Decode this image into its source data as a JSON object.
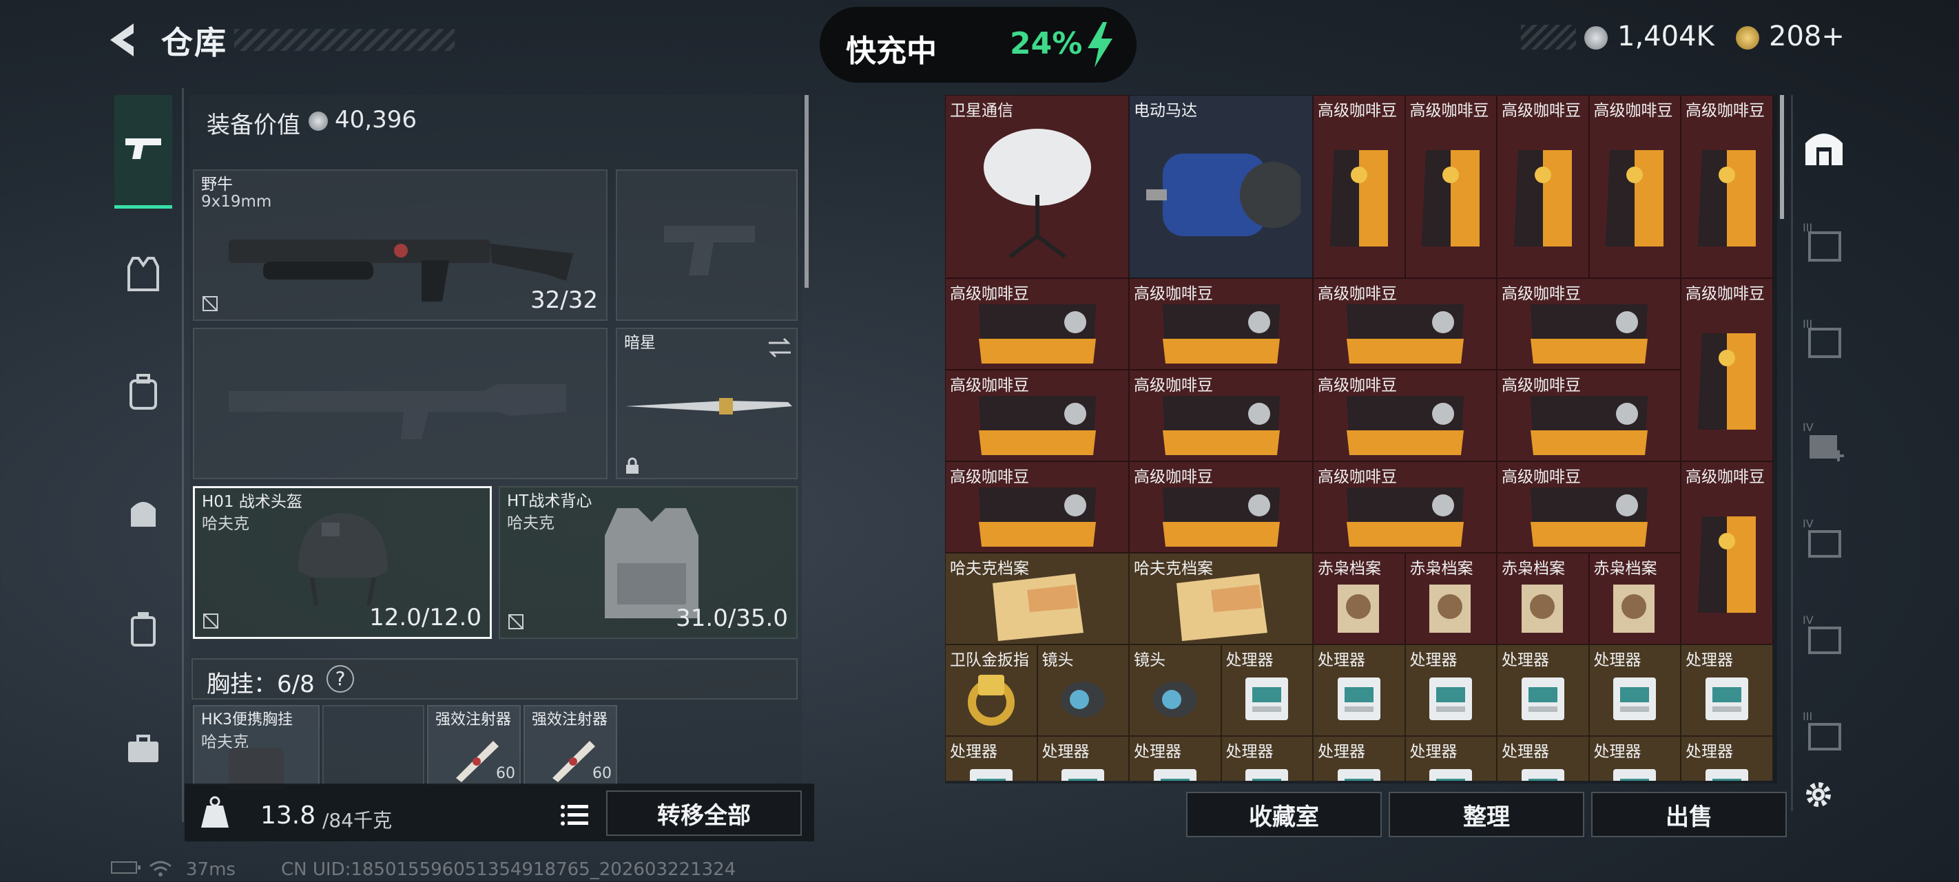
{
  "header": {
    "title": "仓库",
    "charging_label": "快充中",
    "charging_percent": "24%",
    "currency_1": "1,404K",
    "currency_2": "208+"
  },
  "equipment": {
    "label": "装备价值",
    "value": "40,396",
    "primary_weapon": {
      "name": "野牛",
      "sub": "9x19mm",
      "ammo": "32/32"
    },
    "melee": {
      "name": "暗星"
    },
    "helmet": {
      "name": "H01 战术头盔",
      "sub": "哈夫克",
      "durability": "12.0/12.0"
    },
    "armor": {
      "name": "HT战术背心",
      "sub": "哈夫克",
      "durability": "31.0/35.0"
    },
    "rig": {
      "label": "胸挂：6/8",
      "help": "?"
    },
    "rig_items": [
      {
        "name": "HK3便携胸挂",
        "sub": "哈夫克"
      },
      {
        "name": "强效注射器",
        "qty": "60"
      },
      {
        "name": "强效注射器",
        "qty": "60"
      }
    ]
  },
  "bottom": {
    "weight": "13.8",
    "weight_max": "/84千克",
    "transfer_all": "转移全部",
    "vault": "收藏室",
    "sort": "整理",
    "sell": "出售"
  },
  "status": {
    "ping": "37ms",
    "uid": "CN UID:1850155960513549187​65_202603221324"
  },
  "warehouse": {
    "items": [
      {
        "name": "卫星通信",
        "color": "red",
        "art": "dish",
        "x": 0,
        "y": 0,
        "w": 2,
        "h": 2
      },
      {
        "name": "电动马达",
        "color": "blue",
        "art": "motor",
        "x": 2,
        "y": 0,
        "w": 2,
        "h": 2
      },
      {
        "name": "高级咖啡豆",
        "color": "red",
        "art": "bag",
        "x": 4,
        "y": 0,
        "w": 1,
        "h": 2
      },
      {
        "name": "高级咖啡豆",
        "color": "red",
        "art": "bag",
        "x": 5,
        "y": 0,
        "w": 1,
        "h": 2
      },
      {
        "name": "高级咖啡豆",
        "color": "red",
        "art": "bag",
        "x": 6,
        "y": 0,
        "w": 1,
        "h": 2
      },
      {
        "name": "高级咖啡豆",
        "color": "red",
        "art": "bag",
        "x": 7,
        "y": 0,
        "w": 1,
        "h": 2
      },
      {
        "name": "高级咖啡豆",
        "color": "red",
        "art": "bag",
        "x": 8,
        "y": 0,
        "w": 1,
        "h": 2
      },
      {
        "name": "高级咖啡豆",
        "color": "red",
        "art": "bagh",
        "x": 0,
        "y": 2,
        "w": 2,
        "h": 1
      },
      {
        "name": "高级咖啡豆",
        "color": "red",
        "art": "bagh",
        "x": 2,
        "y": 2,
        "w": 2,
        "h": 1
      },
      {
        "name": "高级咖啡豆",
        "color": "red",
        "art": "bagh",
        "x": 4,
        "y": 2,
        "w": 2,
        "h": 1
      },
      {
        "name": "高级咖啡豆",
        "color": "red",
        "art": "bagh",
        "x": 6,
        "y": 2,
        "w": 2,
        "h": 1
      },
      {
        "name": "高级咖啡豆",
        "color": "red",
        "art": "bag",
        "x": 8,
        "y": 2,
        "w": 1,
        "h": 2
      },
      {
        "name": "高级咖啡豆",
        "color": "red",
        "art": "bagh",
        "x": 0,
        "y": 3,
        "w": 2,
        "h": 1
      },
      {
        "name": "高级咖啡豆",
        "color": "red",
        "art": "bagh",
        "x": 2,
        "y": 3,
        "w": 2,
        "h": 1
      },
      {
        "name": "高级咖啡豆",
        "color": "red",
        "art": "bagh",
        "x": 4,
        "y": 3,
        "w": 2,
        "h": 1
      },
      {
        "name": "高级咖啡豆",
        "color": "red",
        "art": "bagh",
        "x": 6,
        "y": 3,
        "w": 2,
        "h": 1
      },
      {
        "name": "高级咖啡豆",
        "color": "red",
        "art": "bagh",
        "x": 0,
        "y": 4,
        "w": 2,
        "h": 1
      },
      {
        "name": "高级咖啡豆",
        "color": "red",
        "art": "bagh",
        "x": 2,
        "y": 4,
        "w": 2,
        "h": 1
      },
      {
        "name": "高级咖啡豆",
        "color": "red",
        "art": "bagh",
        "x": 4,
        "y": 4,
        "w": 2,
        "h": 1
      },
      {
        "name": "高级咖啡豆",
        "color": "red",
        "art": "bagh",
        "x": 6,
        "y": 4,
        "w": 2,
        "h": 1
      },
      {
        "name": "高级咖啡豆",
        "color": "red",
        "art": "bag",
        "x": 8,
        "y": 4,
        "w": 1,
        "h": 2
      },
      {
        "name": "哈夫克档案",
        "color": "gold",
        "art": "folder",
        "x": 0,
        "y": 5,
        "w": 2,
        "h": 1
      },
      {
        "name": "哈夫克档案",
        "color": "gold",
        "art": "folder",
        "x": 2,
        "y": 5,
        "w": 2,
        "h": 1
      },
      {
        "name": "赤枭档案",
        "color": "red",
        "art": "doc",
        "x": 4,
        "y": 5,
        "w": 1,
        "h": 1
      },
      {
        "name": "赤枭档案",
        "color": "red",
        "art": "doc",
        "x": 5,
        "y": 5,
        "w": 1,
        "h": 1
      },
      {
        "name": "赤枭档案",
        "color": "red",
        "art": "doc",
        "x": 6,
        "y": 5,
        "w": 1,
        "h": 1
      },
      {
        "name": "赤枭档案",
        "color": "red",
        "art": "doc",
        "x": 7,
        "y": 5,
        "w": 1,
        "h": 1
      },
      {
        "name": "卫队金扳指",
        "color": "gold",
        "art": "ring",
        "x": 0,
        "y": 6,
        "w": 1,
        "h": 1
      },
      {
        "name": "镜头",
        "color": "gold",
        "art": "lens",
        "x": 1,
        "y": 6,
        "w": 1,
        "h": 1
      },
      {
        "name": "镜头",
        "color": "gold",
        "art": "lens",
        "x": 2,
        "y": 6,
        "w": 1,
        "h": 1
      },
      {
        "name": "处理器",
        "color": "gold",
        "art": "cpu",
        "x": 3,
        "y": 6,
        "w": 1,
        "h": 1
      },
      {
        "name": "处理器",
        "color": "gold",
        "art": "cpu",
        "x": 4,
        "y": 6,
        "w": 1,
        "h": 1
      },
      {
        "name": "处理器",
        "color": "gold",
        "art": "cpu",
        "x": 5,
        "y": 6,
        "w": 1,
        "h": 1
      },
      {
        "name": "处理器",
        "color": "gold",
        "art": "cpu",
        "x": 6,
        "y": 6,
        "w": 1,
        "h": 1
      },
      {
        "name": "处理器",
        "color": "gold",
        "art": "cpu",
        "x": 7,
        "y": 6,
        "w": 1,
        "h": 1
      },
      {
        "name": "处理器",
        "color": "gold",
        "art": "cpu",
        "x": 8,
        "y": 6,
        "w": 1,
        "h": 1
      },
      {
        "name": "处理器",
        "color": "gold",
        "art": "cpu",
        "x": 0,
        "y": 7,
        "w": 1,
        "h": 1
      },
      {
        "name": "处理器",
        "color": "gold",
        "art": "cpu",
        "x": 1,
        "y": 7,
        "w": 1,
        "h": 1
      },
      {
        "name": "处理器",
        "color": "gold",
        "art": "cpu",
        "x": 2,
        "y": 7,
        "w": 1,
        "h": 1
      },
      {
        "name": "处理器",
        "color": "gold",
        "art": "cpu",
        "x": 3,
        "y": 7,
        "w": 1,
        "h": 1
      },
      {
        "name": "处理器",
        "color": "gold",
        "art": "cpu",
        "x": 4,
        "y": 7,
        "w": 1,
        "h": 1
      },
      {
        "name": "处理器",
        "color": "gold",
        "art": "cpu",
        "x": 5,
        "y": 7,
        "w": 1,
        "h": 1
      },
      {
        "name": "处理器",
        "color": "gold",
        "art": "cpu",
        "x": 6,
        "y": 7,
        "w": 1,
        "h": 1
      },
      {
        "name": "处理器",
        "color": "gold",
        "art": "cpu",
        "x": 7,
        "y": 7,
        "w": 1,
        "h": 1
      },
      {
        "name": "处理器",
        "color": "gold",
        "art": "cpu",
        "x": 8,
        "y": 7,
        "w": 1,
        "h": 1
      }
    ]
  },
  "colors": {
    "accent": "#38e0a8",
    "charge": "#3ed98a",
    "rarity_red": "#4a1f22",
    "rarity_gold": "#4a3a24",
    "rarity_blue": "#283040"
  }
}
